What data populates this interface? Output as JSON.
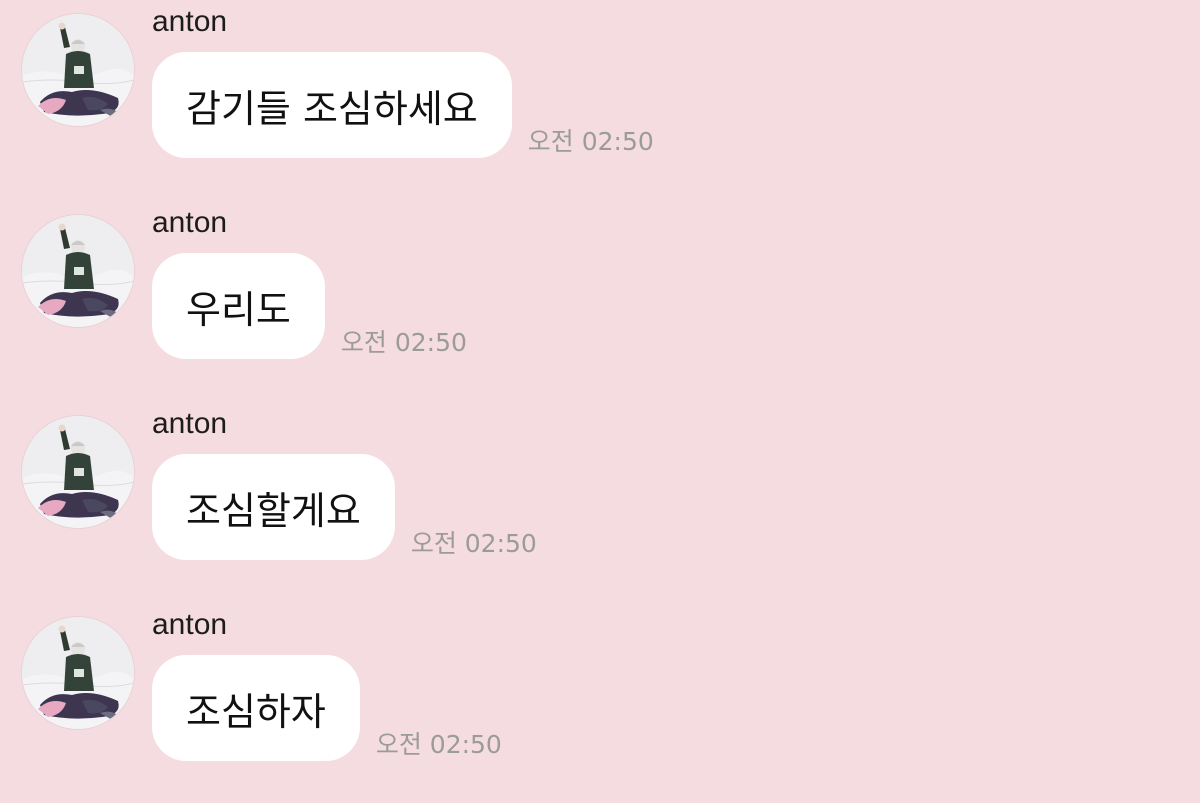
{
  "messages": [
    {
      "sender": "anton",
      "text": "감기들 조심하세요",
      "time": "오전 02:50"
    },
    {
      "sender": "anton",
      "text": "우리도",
      "time": "오전 02:50"
    },
    {
      "sender": "anton",
      "text": "조심할게요",
      "time": "오전 02:50"
    },
    {
      "sender": "anton",
      "text": "조심하자",
      "time": "오전 02:50"
    }
  ],
  "colors": {
    "background": "#f5dce0",
    "bubble": "#ffffff",
    "timestamp": "#9b9b9b",
    "sender": "#1c1c1c"
  }
}
